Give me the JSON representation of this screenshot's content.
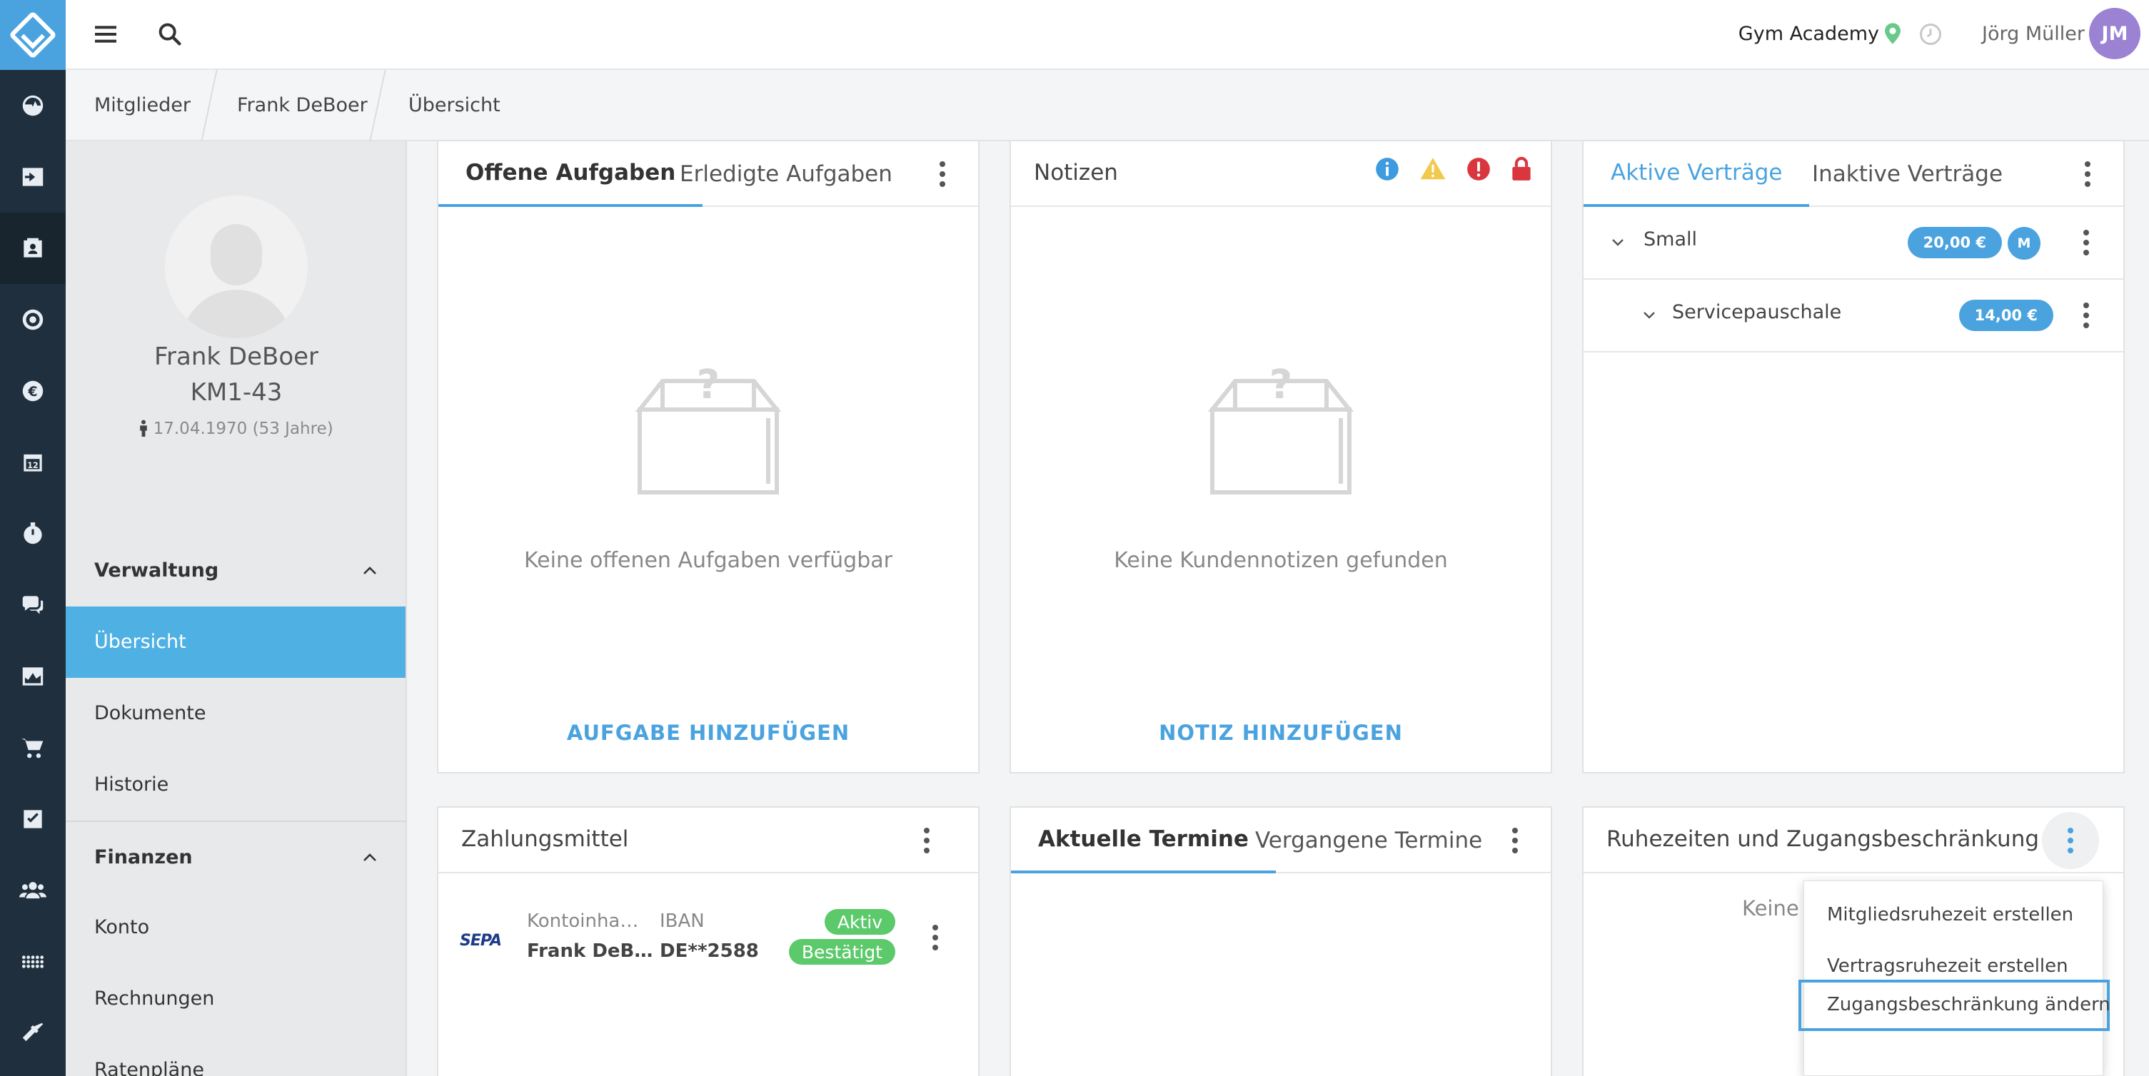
{
  "header": {
    "gym_name": "Gym Academy",
    "user_name": "Jörg Müller",
    "user_initials": "JM"
  },
  "breadcrumb": [
    "Mitglieder",
    "Frank DeBoer",
    "Übersicht"
  ],
  "profile": {
    "name": "Frank DeBoer",
    "member_id": "KM1-43",
    "dob": "17.04.1970 (53 Jahre)"
  },
  "sidebar": {
    "sections": [
      {
        "title": "Verwaltung",
        "items": [
          "Übersicht",
          "Dokumente",
          "Historie"
        ]
      },
      {
        "title": "Finanzen",
        "items": [
          "Konto",
          "Rechnungen",
          "Ratenpläne"
        ]
      }
    ]
  },
  "tasks": {
    "tabs": [
      "Offene Aufgaben",
      "Erledigte Aufgaben"
    ],
    "empty": "Keine offenen Aufgaben verfügbar",
    "action": "AUFGABE HINZUFÜGEN"
  },
  "notes": {
    "title": "Notizen",
    "empty": "Keine Kundennotizen gefunden",
    "action": "NOTIZ HINZUFÜGEN"
  },
  "contracts": {
    "tabs": [
      "Aktive Verträge",
      "Inaktive Verträge"
    ],
    "rows": [
      {
        "label": "Small",
        "price": "20,00 €",
        "badge": "M"
      },
      {
        "label": "Servicepauschale",
        "price": "14,00 €"
      }
    ]
  },
  "payment": {
    "title": "Zahlungsmittel",
    "logo": "SEPA",
    "holder_label": "Kontoinha…",
    "holder_value": "Frank DeB…",
    "iban_label": "IBAN",
    "iban_value": "DE**2588",
    "status_1": "Aktiv",
    "status_2": "Bestätigt"
  },
  "appointments": {
    "tabs": [
      "Aktuelle Termine",
      "Vergangene Termine"
    ]
  },
  "rest": {
    "title": "Ruhezeiten und Zugangsbeschränkung",
    "empty_partial": "Keine",
    "menu": [
      "Mitgliedsruhezeit erstellen",
      "Vertragsruhezeit erstellen",
      "Zugangsbeschränkung ändern"
    ]
  },
  "colors": {
    "accent": "#4aa3df",
    "rail": "#1f2f3d",
    "success": "#5cc96b",
    "avatar": "#9b82d3"
  }
}
